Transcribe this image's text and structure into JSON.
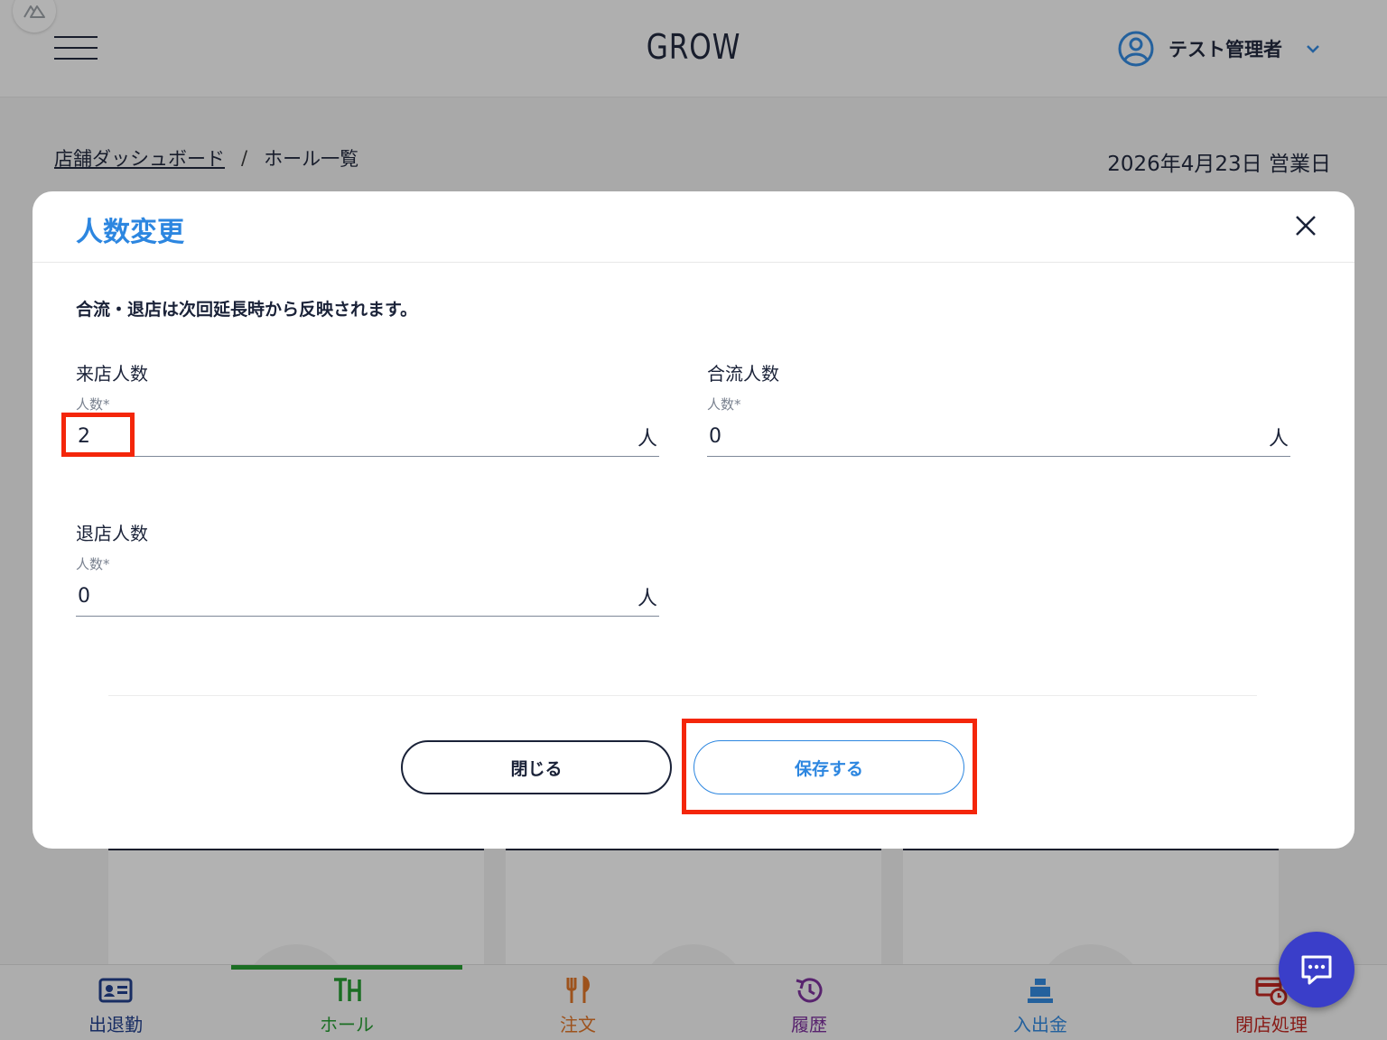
{
  "header": {
    "app_title": "GROW",
    "user_name": "テスト管理者",
    "icons": {
      "menu": "hamburger-menu-icon",
      "user": "user-circle-icon",
      "dropdown": "chevron-down-icon",
      "devtools": "nuxt-devtools-icon"
    }
  },
  "breadcrumb": {
    "link": "店舗ダッシュボード",
    "separator": "/",
    "current": "ホール一覧"
  },
  "business_date": "2026年4月23日 営業日",
  "modal": {
    "title": "人数変更",
    "notice": "合流・退店は次回延長時から反映されます。",
    "fields": [
      {
        "title": "来店人数",
        "label": "人数*",
        "value": "2",
        "unit": "人"
      },
      {
        "title": "合流人数",
        "label": "人数*",
        "value": "0",
        "unit": "人"
      },
      {
        "title": "退店人数",
        "label": "人数*",
        "value": "0",
        "unit": "人"
      }
    ],
    "close_label": "閉じる",
    "save_label": "保存する"
  },
  "bottom_nav": [
    {
      "label": "出退勤",
      "icon": "id-card-icon",
      "color": "#1a3a8a"
    },
    {
      "label": "ホール",
      "icon": "table-icon",
      "color": "#1e9a2b",
      "active": true
    },
    {
      "label": "注文",
      "icon": "fork-knife-icon",
      "color": "#e07020"
    },
    {
      "label": "履歴",
      "icon": "history-icon",
      "color": "#7a2a9a"
    },
    {
      "label": "入出金",
      "icon": "cash-register-icon",
      "color": "#2c86e0"
    },
    {
      "label": "閉店処理",
      "icon": "closing-icon",
      "color": "#c0201a"
    }
  ],
  "chat": {
    "icon": "chat-bubble-icon"
  },
  "colors": {
    "accent": "#2c86e0",
    "navy": "#1a2238",
    "highlight": "#f4260a",
    "fab": "#3a3ec9"
  }
}
